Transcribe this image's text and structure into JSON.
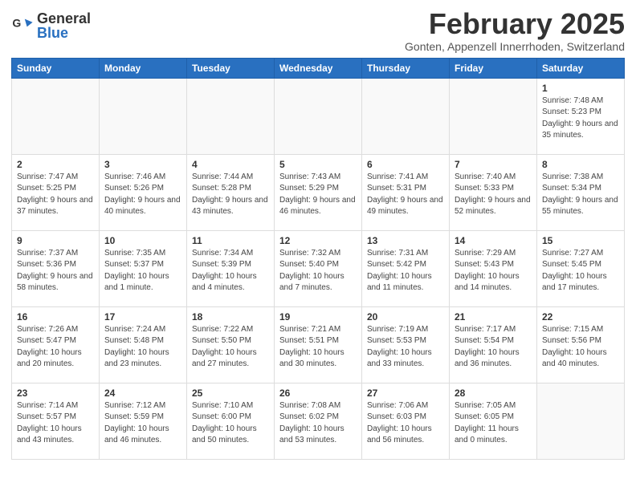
{
  "header": {
    "logo_general": "General",
    "logo_blue": "Blue",
    "month": "February 2025",
    "location": "Gonten, Appenzell Innerrhoden, Switzerland"
  },
  "weekdays": [
    "Sunday",
    "Monday",
    "Tuesday",
    "Wednesday",
    "Thursday",
    "Friday",
    "Saturday"
  ],
  "weeks": [
    [
      {
        "day": null,
        "info": null
      },
      {
        "day": null,
        "info": null
      },
      {
        "day": null,
        "info": null
      },
      {
        "day": null,
        "info": null
      },
      {
        "day": null,
        "info": null
      },
      {
        "day": null,
        "info": null
      },
      {
        "day": "1",
        "info": "Sunrise: 7:48 AM\nSunset: 5:23 PM\nDaylight: 9 hours and 35 minutes."
      }
    ],
    [
      {
        "day": "2",
        "info": "Sunrise: 7:47 AM\nSunset: 5:25 PM\nDaylight: 9 hours and 37 minutes."
      },
      {
        "day": "3",
        "info": "Sunrise: 7:46 AM\nSunset: 5:26 PM\nDaylight: 9 hours and 40 minutes."
      },
      {
        "day": "4",
        "info": "Sunrise: 7:44 AM\nSunset: 5:28 PM\nDaylight: 9 hours and 43 minutes."
      },
      {
        "day": "5",
        "info": "Sunrise: 7:43 AM\nSunset: 5:29 PM\nDaylight: 9 hours and 46 minutes."
      },
      {
        "day": "6",
        "info": "Sunrise: 7:41 AM\nSunset: 5:31 PM\nDaylight: 9 hours and 49 minutes."
      },
      {
        "day": "7",
        "info": "Sunrise: 7:40 AM\nSunset: 5:33 PM\nDaylight: 9 hours and 52 minutes."
      },
      {
        "day": "8",
        "info": "Sunrise: 7:38 AM\nSunset: 5:34 PM\nDaylight: 9 hours and 55 minutes."
      }
    ],
    [
      {
        "day": "9",
        "info": "Sunrise: 7:37 AM\nSunset: 5:36 PM\nDaylight: 9 hours and 58 minutes."
      },
      {
        "day": "10",
        "info": "Sunrise: 7:35 AM\nSunset: 5:37 PM\nDaylight: 10 hours and 1 minute."
      },
      {
        "day": "11",
        "info": "Sunrise: 7:34 AM\nSunset: 5:39 PM\nDaylight: 10 hours and 4 minutes."
      },
      {
        "day": "12",
        "info": "Sunrise: 7:32 AM\nSunset: 5:40 PM\nDaylight: 10 hours and 7 minutes."
      },
      {
        "day": "13",
        "info": "Sunrise: 7:31 AM\nSunset: 5:42 PM\nDaylight: 10 hours and 11 minutes."
      },
      {
        "day": "14",
        "info": "Sunrise: 7:29 AM\nSunset: 5:43 PM\nDaylight: 10 hours and 14 minutes."
      },
      {
        "day": "15",
        "info": "Sunrise: 7:27 AM\nSunset: 5:45 PM\nDaylight: 10 hours and 17 minutes."
      }
    ],
    [
      {
        "day": "16",
        "info": "Sunrise: 7:26 AM\nSunset: 5:47 PM\nDaylight: 10 hours and 20 minutes."
      },
      {
        "day": "17",
        "info": "Sunrise: 7:24 AM\nSunset: 5:48 PM\nDaylight: 10 hours and 23 minutes."
      },
      {
        "day": "18",
        "info": "Sunrise: 7:22 AM\nSunset: 5:50 PM\nDaylight: 10 hours and 27 minutes."
      },
      {
        "day": "19",
        "info": "Sunrise: 7:21 AM\nSunset: 5:51 PM\nDaylight: 10 hours and 30 minutes."
      },
      {
        "day": "20",
        "info": "Sunrise: 7:19 AM\nSunset: 5:53 PM\nDaylight: 10 hours and 33 minutes."
      },
      {
        "day": "21",
        "info": "Sunrise: 7:17 AM\nSunset: 5:54 PM\nDaylight: 10 hours and 36 minutes."
      },
      {
        "day": "22",
        "info": "Sunrise: 7:15 AM\nSunset: 5:56 PM\nDaylight: 10 hours and 40 minutes."
      }
    ],
    [
      {
        "day": "23",
        "info": "Sunrise: 7:14 AM\nSunset: 5:57 PM\nDaylight: 10 hours and 43 minutes."
      },
      {
        "day": "24",
        "info": "Sunrise: 7:12 AM\nSunset: 5:59 PM\nDaylight: 10 hours and 46 minutes."
      },
      {
        "day": "25",
        "info": "Sunrise: 7:10 AM\nSunset: 6:00 PM\nDaylight: 10 hours and 50 minutes."
      },
      {
        "day": "26",
        "info": "Sunrise: 7:08 AM\nSunset: 6:02 PM\nDaylight: 10 hours and 53 minutes."
      },
      {
        "day": "27",
        "info": "Sunrise: 7:06 AM\nSunset: 6:03 PM\nDaylight: 10 hours and 56 minutes."
      },
      {
        "day": "28",
        "info": "Sunrise: 7:05 AM\nSunset: 6:05 PM\nDaylight: 11 hours and 0 minutes."
      },
      {
        "day": null,
        "info": null
      }
    ]
  ]
}
